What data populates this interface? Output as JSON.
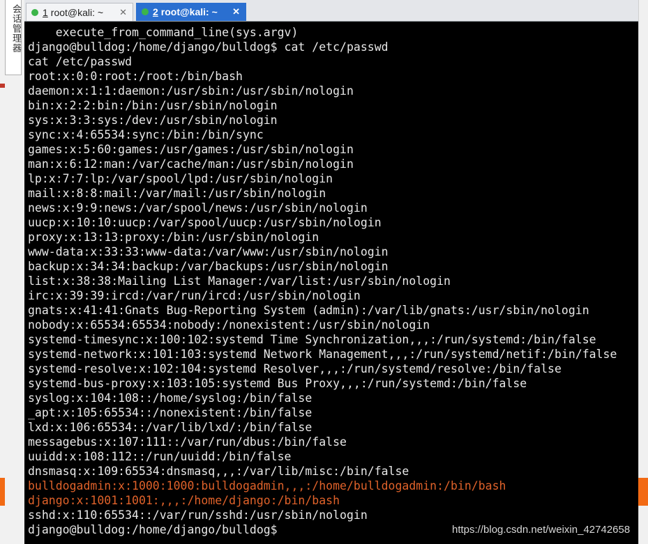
{
  "sidebar": {
    "vertical_label": "会话管理器"
  },
  "tabs": [
    {
      "number": "1",
      "title": "root@kali: ~",
      "active": false,
      "dot_color": "#3cb54a",
      "close": "✕"
    },
    {
      "number": "2",
      "title": "root@kali: ~",
      "active": true,
      "dot_color": "#3cb54a",
      "close": "✕"
    }
  ],
  "terminal": {
    "lines": [
      {
        "text": "    execute_from_command_line(sys.argv)",
        "highlight": false
      },
      {
        "text": "django@bulldog:/home/django/bulldog$ cat /etc/passwd",
        "highlight": false
      },
      {
        "text": "cat /etc/passwd",
        "highlight": false
      },
      {
        "text": "root:x:0:0:root:/root:/bin/bash",
        "highlight": false
      },
      {
        "text": "daemon:x:1:1:daemon:/usr/sbin:/usr/sbin/nologin",
        "highlight": false
      },
      {
        "text": "bin:x:2:2:bin:/bin:/usr/sbin/nologin",
        "highlight": false
      },
      {
        "text": "sys:x:3:3:sys:/dev:/usr/sbin/nologin",
        "highlight": false
      },
      {
        "text": "sync:x:4:65534:sync:/bin:/bin/sync",
        "highlight": false
      },
      {
        "text": "games:x:5:60:games:/usr/games:/usr/sbin/nologin",
        "highlight": false
      },
      {
        "text": "man:x:6:12:man:/var/cache/man:/usr/sbin/nologin",
        "highlight": false
      },
      {
        "text": "lp:x:7:7:lp:/var/spool/lpd:/usr/sbin/nologin",
        "highlight": false
      },
      {
        "text": "mail:x:8:8:mail:/var/mail:/usr/sbin/nologin",
        "highlight": false
      },
      {
        "text": "news:x:9:9:news:/var/spool/news:/usr/sbin/nologin",
        "highlight": false
      },
      {
        "text": "uucp:x:10:10:uucp:/var/spool/uucp:/usr/sbin/nologin",
        "highlight": false
      },
      {
        "text": "proxy:x:13:13:proxy:/bin:/usr/sbin/nologin",
        "highlight": false
      },
      {
        "text": "www-data:x:33:33:www-data:/var/www:/usr/sbin/nologin",
        "highlight": false
      },
      {
        "text": "backup:x:34:34:backup:/var/backups:/usr/sbin/nologin",
        "highlight": false
      },
      {
        "text": "list:x:38:38:Mailing List Manager:/var/list:/usr/sbin/nologin",
        "highlight": false
      },
      {
        "text": "irc:x:39:39:ircd:/var/run/ircd:/usr/sbin/nologin",
        "highlight": false
      },
      {
        "text": "gnats:x:41:41:Gnats Bug-Reporting System (admin):/var/lib/gnats:/usr/sbin/nologin",
        "highlight": false
      },
      {
        "text": "nobody:x:65534:65534:nobody:/nonexistent:/usr/sbin/nologin",
        "highlight": false
      },
      {
        "text": "systemd-timesync:x:100:102:systemd Time Synchronization,,,:/run/systemd:/bin/false",
        "highlight": false
      },
      {
        "text": "systemd-network:x:101:103:systemd Network Management,,,:/run/systemd/netif:/bin/false",
        "highlight": false
      },
      {
        "text": "systemd-resolve:x:102:104:systemd Resolver,,,:/run/systemd/resolve:/bin/false",
        "highlight": false
      },
      {
        "text": "systemd-bus-proxy:x:103:105:systemd Bus Proxy,,,:/run/systemd:/bin/false",
        "highlight": false
      },
      {
        "text": "syslog:x:104:108::/home/syslog:/bin/false",
        "highlight": false
      },
      {
        "text": "_apt:x:105:65534::/nonexistent:/bin/false",
        "highlight": false
      },
      {
        "text": "lxd:x:106:65534::/var/lib/lxd/:/bin/false",
        "highlight": false
      },
      {
        "text": "messagebus:x:107:111::/var/run/dbus:/bin/false",
        "highlight": false
      },
      {
        "text": "uuidd:x:108:112::/run/uuidd:/bin/false",
        "highlight": false
      },
      {
        "text": "dnsmasq:x:109:65534:dnsmasq,,,:/var/lib/misc:/bin/false",
        "highlight": false
      },
      {
        "text": "bulldogadmin:x:1000:1000:bulldogadmin,,,:/home/bulldogadmin:/bin/bash",
        "highlight": true
      },
      {
        "text": "django:x:1001:1001:,,,:/home/django:/bin/bash",
        "highlight": true
      },
      {
        "text": "sshd:x:110:65534::/var/run/sshd:/usr/sbin/nologin",
        "highlight": false
      },
      {
        "text": "django@bulldog:/home/django/bulldog$ ",
        "highlight": false
      }
    ]
  },
  "colors": {
    "terminal_bg": "#000000",
    "terminal_fg": "#e8e8e8",
    "highlight_fg": "#e0622a",
    "active_tab": "#2a6fd0",
    "orange_band": "#f26a14"
  },
  "watermark": "https://blog.csdn.net/weixin_42742658"
}
